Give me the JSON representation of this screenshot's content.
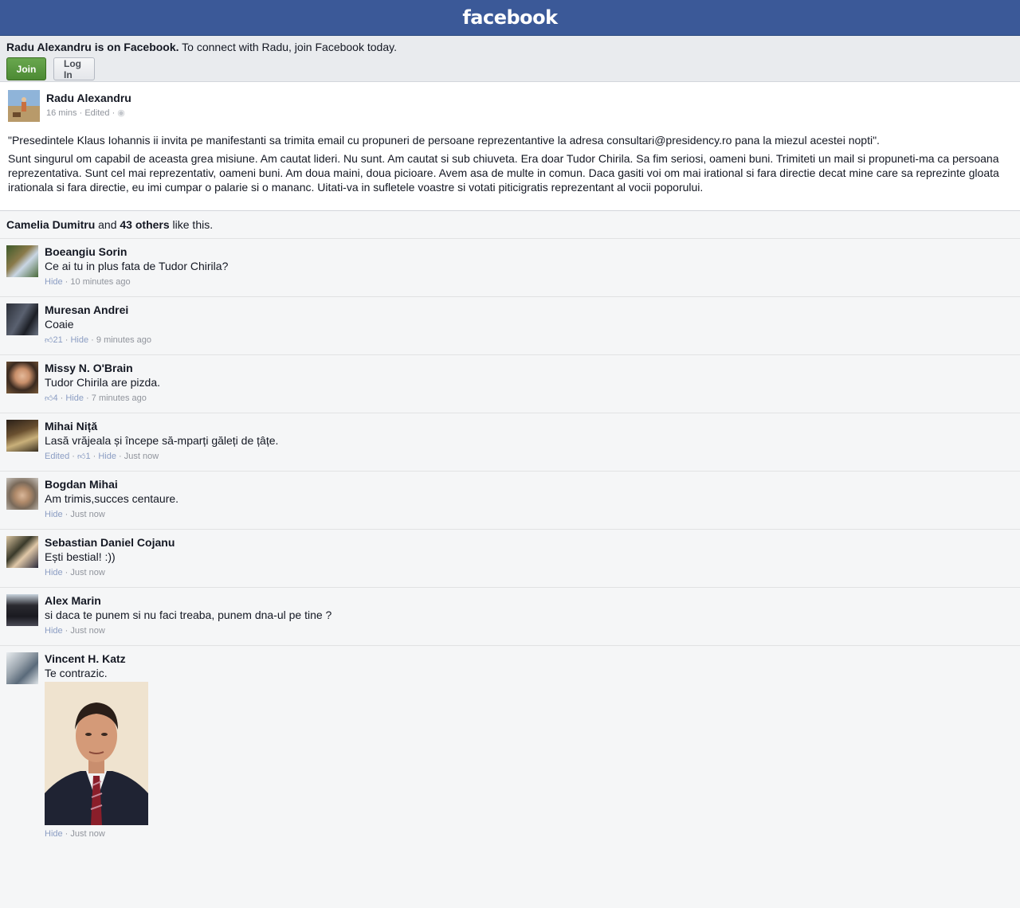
{
  "header": {
    "logo": "facebook"
  },
  "join_bar": {
    "name_bold": "Radu Alexandru is on Facebook.",
    "message": " To connect with Radu, join Facebook today.",
    "join_label": "Join",
    "login_label": "Log In"
  },
  "post": {
    "author": "Radu Alexandru",
    "time": "16 mins",
    "edited": "Edited",
    "separator": " · ",
    "paragraph1": "\"Presedintele Klaus Iohannis ii invita pe manifestanti sa trimita email cu propuneri de persoane reprezentantive la adresa consultari@presidency.ro pana la miezul acestei nopti\".",
    "paragraph2": "Sunt singurul om capabil de aceasta grea misiune. Am cautat lideri. Nu sunt. Am cautat si sub chiuveta. Era doar Tudor Chirila. Sa fim seriosi, oameni buni. Trimiteti un mail si propuneti-ma ca persoana reprezentativa. Sunt cel mai reprezentativ, oameni buni. Am doua maini, doua picioare. Avem asa de multe in comun. Daca gasiti voi om mai irational si fara directie decat mine care sa reprezinte gloata irationala si fara directie, eu imi cumpar o palarie si o mananc. Uitati-va in sufletele voastre si votati piticigratis reprezentant al vocii poporului."
  },
  "likes": {
    "name": "Camelia Dumitru",
    "and": " and ",
    "others": "43 others",
    "suffix": " like this."
  },
  "comments": [
    {
      "name": "Boeangiu Sorin",
      "text": "Ce ai tu in plus fata de Tudor Chirila?",
      "hide": "Hide",
      "time": "10 minutes ago"
    },
    {
      "name": "Muresan Andrei",
      "text": "Coaie",
      "likes": "21",
      "hide": "Hide",
      "time": "9 minutes ago"
    },
    {
      "name": "Missy N. O'Brain",
      "text": "Tudor Chirila are pizda.",
      "likes": "4",
      "hide": "Hide",
      "time": "7 minutes ago"
    },
    {
      "name": "Mihai Niță",
      "text": "Lasă vrăjeala și începe să-mparți găleți de țâțe.",
      "edited": "Edited",
      "likes": "1",
      "hide": "Hide",
      "time": "Just now"
    },
    {
      "name": "Bogdan Mihai",
      "text": "Am trimis,succes centaure.",
      "hide": "Hide",
      "time": "Just now"
    },
    {
      "name": "Sebastian Daniel Cojanu",
      "text": "Ești bestial! :))",
      "hide": "Hide",
      "time": "Just now"
    },
    {
      "name": "Alex Marin",
      "text": "si daca te punem si nu faci treaba, punem dna-ul pe tine ?",
      "hide": "Hide",
      "time": "Just now"
    },
    {
      "name": "Vincent H. Katz",
      "text": "Te contrazic.",
      "hide": "Hide",
      "time": "Just now"
    }
  ],
  "sep": " · ",
  "colors": {
    "brand": "#3b5998",
    "join_green": "#4c8a34",
    "link_muted": "#8b9dc3"
  }
}
